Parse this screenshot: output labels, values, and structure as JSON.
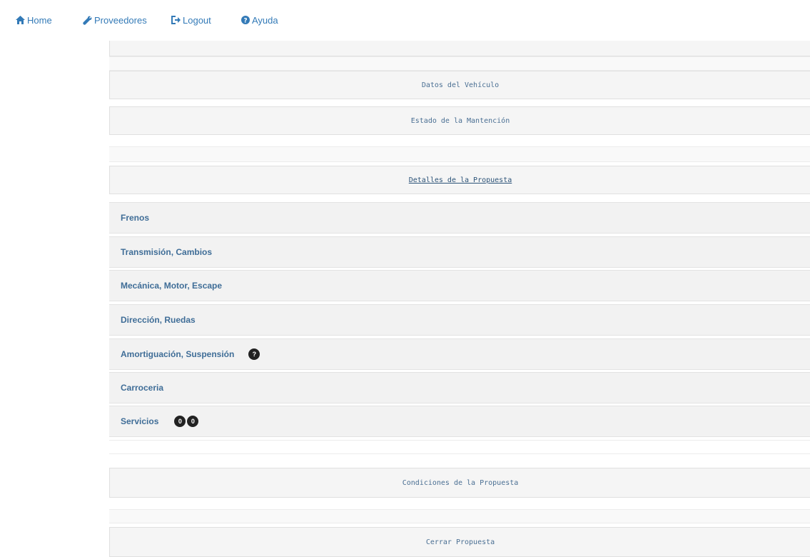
{
  "nav": {
    "home": "Home",
    "providers": "Proveedores",
    "logout": "Logout",
    "help": "Ayuda"
  },
  "sections": {
    "vehicle": "Datos del Vehículo",
    "maintenance": "Estado de la Mantención",
    "details": "Detalles de la Propuesta",
    "conditions": "Condiciones de la Propuesta",
    "close": "Cerrar Propuesta"
  },
  "categories": [
    {
      "label": "Frenos"
    },
    {
      "label": "Transmisión, Cambios"
    },
    {
      "label": "Mecánica, Motor, Escape"
    },
    {
      "label": "Dirección, Ruedas"
    },
    {
      "label": "Amortiguación, Suspensión",
      "badges": [
        "?"
      ]
    },
    {
      "label": "Carroceria"
    },
    {
      "label": "Servicios",
      "badges": [
        "0",
        "0"
      ]
    }
  ]
}
